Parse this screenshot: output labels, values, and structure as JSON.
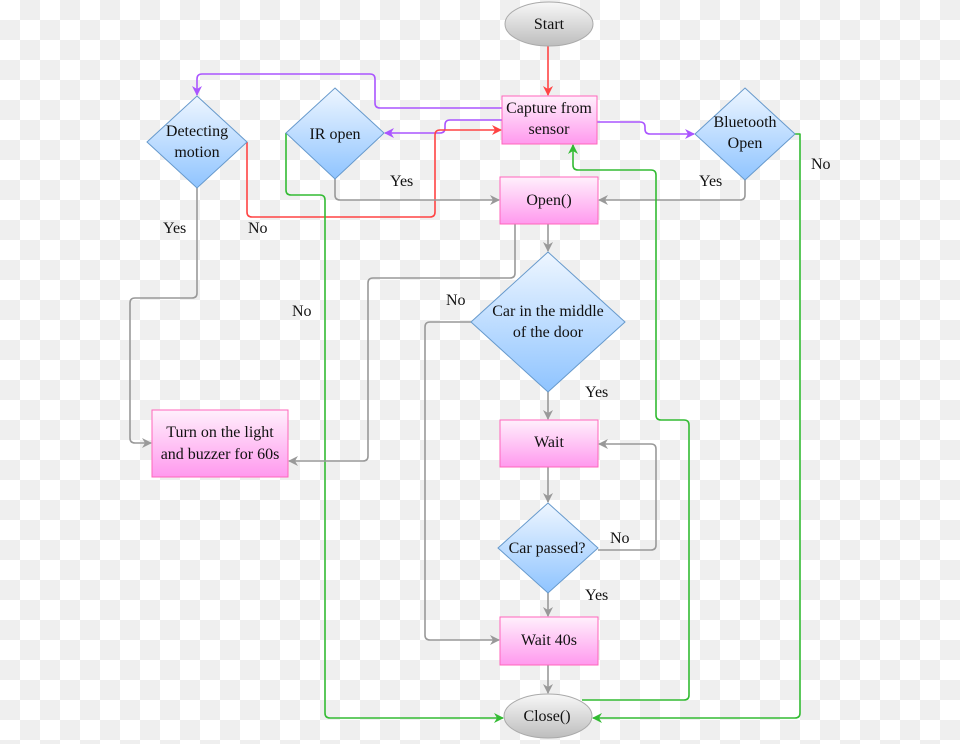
{
  "colors": {
    "gray": "#999999",
    "red": "#ff4444",
    "purple": "#aa55ff",
    "green": "#33bb33",
    "process_fill": "#ff99ee",
    "process_stroke": "#ff66bb",
    "decision_fill": "#99ccff",
    "decision_stroke": "#6699cc",
    "terminal_fill": "#cccccc"
  },
  "nodes": {
    "start": {
      "label": [
        "Start"
      ]
    },
    "capture": {
      "label": [
        "Capture from",
        "sensor"
      ]
    },
    "open": {
      "label": [
        "Open()"
      ]
    },
    "detecting": {
      "label": [
        "Detecting",
        "motion"
      ]
    },
    "ir": {
      "label": [
        "IR open"
      ]
    },
    "bluetooth": {
      "label": [
        "Bluetooth",
        "Open"
      ]
    },
    "car_middle": {
      "label": [
        "Car in the middle",
        "of the door"
      ]
    },
    "wait": {
      "label": [
        "Wait"
      ]
    },
    "car_passed": {
      "label": [
        "Car passed?"
      ]
    },
    "wait40": {
      "label": [
        "Wait 40s"
      ]
    },
    "close": {
      "label": [
        "Close()"
      ]
    },
    "light": {
      "label": [
        "Turn on the light",
        "and buzzer for 60s"
      ]
    }
  },
  "edge_labels": {
    "detecting_yes": "Yes",
    "detecting_no": "No",
    "ir_yes": "Yes",
    "ir_no": "No",
    "bluetooth_yes": "Yes",
    "bluetooth_no": "No",
    "car_middle_no": "No",
    "car_middle_yes": "Yes",
    "car_passed_no": "No",
    "car_passed_yes": "Yes"
  }
}
